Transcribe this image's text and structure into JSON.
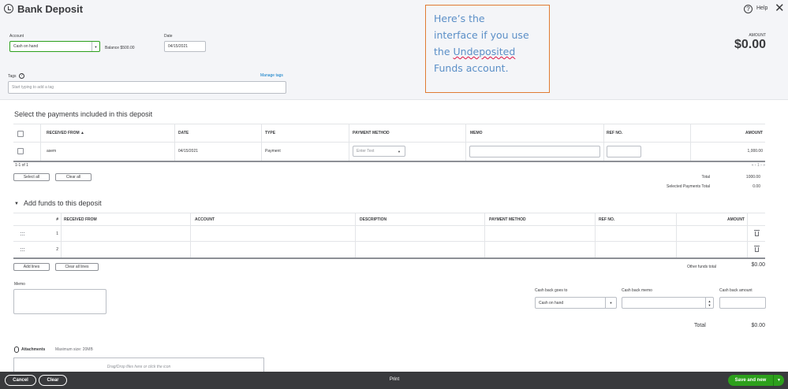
{
  "header": {
    "title": "Bank Deposit",
    "help_label": "Help",
    "account_label": "Account",
    "account_value": "Cash on hand",
    "balance_text": "Balance $500.00",
    "date_label": "Date",
    "date_value": "04/15/2021",
    "amount_label": "AMOUNT",
    "amount_value": "$0.00",
    "tags_label": "Tags",
    "manage_tags": "Manage tags",
    "tags_placeholder": "Start typing to add a tag"
  },
  "note": {
    "line1": "Here’s the",
    "line2": "interface if you use",
    "line3_pre": "the ",
    "line3_link": "Undeposited",
    "line4": "Funds account."
  },
  "payments": {
    "section_title": "Select the payments included in this deposit",
    "columns": [
      "RECEIVED FROM ▲",
      "DATE",
      "TYPE",
      "PAYMENT METHOD",
      "MEMO",
      "REF NO.",
      "AMOUNT"
    ],
    "rows": [
      {
        "received_from": "asem",
        "date": "04/15/2021",
        "type": "Payment",
        "payment_method_placeholder": "Enter Text",
        "memo": "",
        "ref_no": "",
        "amount": "1,000.00"
      }
    ],
    "range_text": "1-1 of 1",
    "pager": "« ‹ 1 › »",
    "select_all": "Select all",
    "clear_all": "Clear all",
    "total_label": "Total",
    "total_value": "1000.00",
    "selected_total_label": "Selected Payments Total",
    "selected_total_value": "0.00"
  },
  "funds": {
    "section_title": "Add funds to this deposit",
    "columns": [
      "#",
      "RECEIVED FROM",
      "ACCOUNT",
      "DESCRIPTION",
      "PAYMENT METHOD",
      "REF NO.",
      "AMOUNT"
    ],
    "rows": [
      {
        "num": "1"
      },
      {
        "num": "2"
      }
    ],
    "add_lines": "Add lines",
    "clear_all_lines": "Clear all lines",
    "other_total_label": "Other funds total",
    "other_total_value": "$0.00"
  },
  "bottom": {
    "memo_label": "Memo",
    "cash_back_goes_to_label": "Cash back goes to",
    "cash_back_goes_to_value": "Cash on hand",
    "cash_back_memo_label": "Cash back memo",
    "cash_back_amount_label": "Cash back amount",
    "total_label": "Total",
    "total_value": "$0.00",
    "attachments_label": "Attachments",
    "max_size": "Maximum size: 20MB",
    "drop_text": "Drag/Drop files here or click the icon"
  },
  "footer": {
    "cancel": "Cancel",
    "clear": "Clear",
    "print": "Print",
    "save_and_new": "Save and new"
  },
  "colors": {
    "accent_green": "#2ca01c",
    "link_blue": "#0077c5",
    "footer_bg": "#393a3d",
    "note_border": "#e07b32",
    "note_text": "#5b8fc7"
  }
}
